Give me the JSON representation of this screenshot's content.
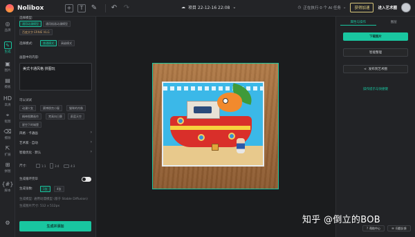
{
  "app": {
    "brand": "Nolibox"
  },
  "topbar": {
    "project_name": "项目 22-12-16 22:08",
    "queue_status": "正在执行 0 个 AI 任务",
    "boost_label": "获得加速",
    "join_label": "进入艺术圈"
  },
  "rail": [
    {
      "icon": "◎",
      "label": "品牌"
    },
    {
      "icon": "✎",
      "label": "生成"
    },
    {
      "icon": "▣",
      "label": "图片"
    },
    {
      "icon": "▤",
      "label": "模板"
    },
    {
      "icon": "HD",
      "label": "高清"
    },
    {
      "icon": "⌖",
      "label": "抠图"
    },
    {
      "icon": "⌫",
      "label": "擦除"
    },
    {
      "icon": "⇱",
      "label": "扩展"
    },
    {
      "icon": "⊞",
      "label": "拼图"
    },
    {
      "icon": "{#}",
      "label": "脚本"
    }
  ],
  "left_panel": {
    "model_label": "选择模型:",
    "model_chips": [
      "通用动漫模型",
      "通用插画动漫模型"
    ],
    "model_note": "百度文字 ERNIE ViLG",
    "mode_label": "选择模式:",
    "mode_chips": [
      "普通模式",
      "高级模式"
    ],
    "prompt_label": "画面中的内容:",
    "prompt_value": "美式卡通风格 拼图玩",
    "try_label": "可以试试",
    "suggestions": [
      "动漫少女",
      "赛博朋克小屋",
      "猫咪的肖像",
      "精神图腾画作",
      "梵高向日葵",
      "蔚蓝天空",
      "星空下的城堡"
    ],
    "style_row": "风格 · 卡通画",
    "artist_row": "艺术家 · 自动",
    "optimize_row": "智能优化 · 默认",
    "size_label": "尺寸:",
    "ratios": [
      "1:1",
      "3:4",
      "4:3"
    ],
    "loop_label": "生成循环完毕",
    "count_label": "生成张数:",
    "counts": [
      "1张",
      "4张"
    ],
    "model_info": "生成模型: 通用动漫模型 (基于 Stable Diffusion)",
    "size_info": "生成图片尺寸: 512 x 512px",
    "generate_button": "生成并添加"
  },
  "right_panel": {
    "tabs": [
      "属性与操作",
      "图层"
    ],
    "buttons": [
      "下载图片",
      "智能整理",
      "发布到艺术圈"
    ],
    "link": "操作提示与快捷键",
    "help_center": "帮助中心",
    "feedback": "问题反馈"
  },
  "watermark": "知乎 @倒立的BOB",
  "colors": {
    "accent": "#19c6a0",
    "background": "#1e1f22",
    "panel": "#222326"
  }
}
